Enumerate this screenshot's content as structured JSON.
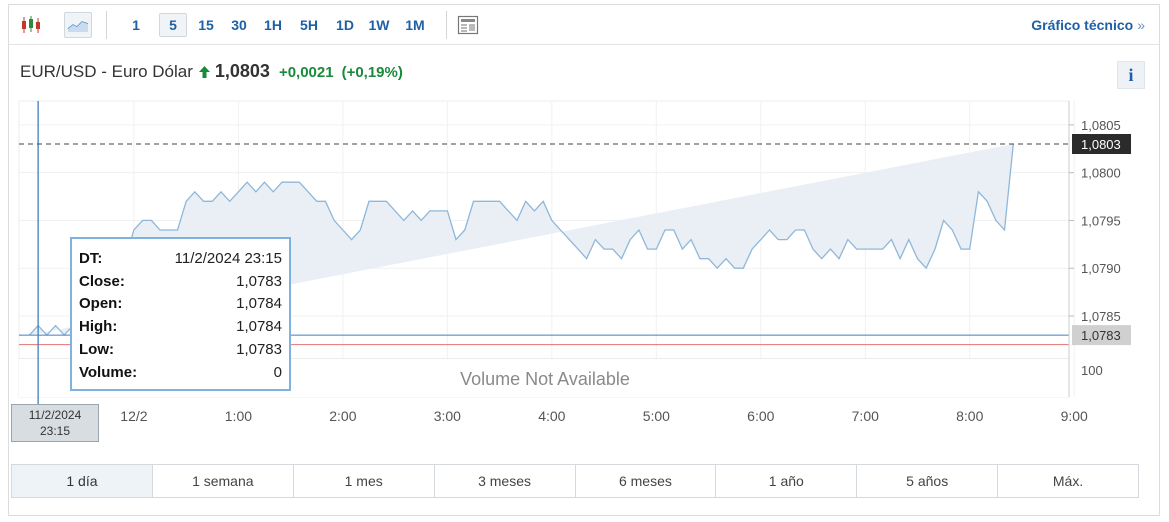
{
  "toolbar": {
    "intervals": [
      "1",
      "5",
      "15",
      "30",
      "1H",
      "5H",
      "1D",
      "1W",
      "1M"
    ],
    "active_interval": "5",
    "tech_link": "Gráfico técnico",
    "tech_arrow": "»"
  },
  "quote": {
    "name": "EUR/USD - Euro Dólar",
    "price": "1,0803",
    "change": "+0,0021",
    "change_pct": "(+0,19%)",
    "direction": "up",
    "up_color": "#1a8a3a"
  },
  "info_label": "i",
  "tooltip": {
    "rows": [
      {
        "key": "DT:",
        "value": "11/2/2024 23:15"
      },
      {
        "key": "Close:",
        "value": "1,0783"
      },
      {
        "key": "Open:",
        "value": "1,0784"
      },
      {
        "key": "High:",
        "value": "1,0784"
      },
      {
        "key": "Low:",
        "value": "1,0783"
      },
      {
        "key": "Volume:",
        "value": "0"
      }
    ]
  },
  "crosshair_date": {
    "line1": "11/2/2024",
    "line2": "23:15"
  },
  "ranges": [
    "1 día",
    "1 semana",
    "1 mes",
    "3 meses",
    "6 meses",
    "1 año",
    "5 años",
    "Máx."
  ],
  "active_range": "1 día",
  "chart_data": {
    "type": "area",
    "x": [
      -1.0,
      -0.917,
      -0.833,
      -0.75,
      -0.667,
      -0.583,
      -0.5,
      -0.417,
      -0.333,
      -0.25,
      -0.167,
      -0.083,
      0.0,
      0.083,
      0.167,
      0.25,
      0.333,
      0.417,
      0.5,
      0.583,
      0.667,
      0.75,
      0.833,
      0.917,
      1.0,
      1.083,
      1.167,
      1.25,
      1.333,
      1.417,
      1.5,
      1.583,
      1.667,
      1.75,
      1.833,
      1.917,
      2.0,
      2.083,
      2.167,
      2.25,
      2.333,
      2.417,
      2.5,
      2.583,
      2.667,
      2.75,
      2.833,
      2.917,
      3.0,
      3.083,
      3.167,
      3.25,
      3.333,
      3.417,
      3.5,
      3.583,
      3.667,
      3.75,
      3.833,
      3.917,
      4.0,
      4.083,
      4.167,
      4.25,
      4.333,
      4.417,
      4.5,
      4.583,
      4.667,
      4.75,
      4.833,
      4.917,
      5.0,
      5.083,
      5.167,
      5.25,
      5.333,
      5.417,
      5.5,
      5.583,
      5.667,
      5.75,
      5.833,
      5.917,
      6.0,
      6.083,
      6.167,
      6.25,
      6.333,
      6.417,
      6.5,
      6.583,
      6.667,
      6.75,
      6.833,
      6.917,
      7.0,
      7.083,
      7.167,
      7.25,
      7.333,
      7.417,
      7.5,
      7.583,
      7.667,
      7.75,
      7.833,
      7.917,
      8.0,
      8.083,
      8.167,
      8.25,
      8.333,
      8.417,
      8.5,
      8.583,
      8.667,
      8.75,
      8.833
    ],
    "values": [
      1.0783,
      1.0784,
      1.0783,
      1.0784,
      1.0783,
      1.0784,
      1.0786,
      1.0787,
      1.0788,
      1.079,
      1.0792,
      1.0791,
      1.0794,
      1.0795,
      1.0795,
      1.0794,
      1.0794,
      1.0794,
      1.0797,
      1.0798,
      1.0797,
      1.0797,
      1.0798,
      1.0797,
      1.0798,
      1.0799,
      1.0798,
      1.0799,
      1.0798,
      1.0799,
      1.0799,
      1.0799,
      1.0798,
      1.0797,
      1.0797,
      1.0795,
      1.0794,
      1.0793,
      1.0794,
      1.0797,
      1.0797,
      1.0797,
      1.0796,
      1.0795,
      1.0796,
      1.0795,
      1.0796,
      1.0796,
      1.0796,
      1.0793,
      1.0794,
      1.0797,
      1.0797,
      1.0797,
      1.0797,
      1.0796,
      1.0795,
      1.0797,
      1.0796,
      1.0797,
      1.0795,
      1.0794,
      1.0793,
      1.0792,
      1.0791,
      1.0793,
      1.0792,
      1.0792,
      1.0791,
      1.0793,
      1.0794,
      1.0792,
      1.0792,
      1.0794,
      1.0794,
      1.0792,
      1.0793,
      1.0791,
      1.0791,
      1.079,
      1.0791,
      1.079,
      1.079,
      1.0792,
      1.0793,
      1.0794,
      1.0793,
      1.0793,
      1.0794,
      1.0794,
      1.0792,
      1.0791,
      1.0792,
      1.0791,
      1.0793,
      1.0792,
      1.0792,
      1.0792,
      1.0792,
      1.0793,
      1.0791,
      1.0793,
      1.0791,
      1.079,
      1.0792,
      1.0795,
      1.0794,
      1.0792,
      1.0792,
      1.0798,
      1.0797,
      1.0795,
      1.0794,
      1.0803
    ],
    "y_ticks": [
      "1,0805",
      "1,0800",
      "1,0795",
      "1,0790",
      "1,0785"
    ],
    "y_tick_values": [
      1.0805,
      1.08,
      1.0795,
      1.079,
      1.0785
    ],
    "ylim": [
      1.07805,
      1.08075
    ],
    "x_ticks": [
      "12/2",
      "1:00",
      "2:00",
      "3:00",
      "4:00",
      "5:00",
      "6:00",
      "7:00",
      "8:00",
      "9:00"
    ],
    "x_tick_values": [
      0,
      1,
      2,
      3,
      4,
      5,
      6,
      7,
      8,
      9
    ],
    "xlim": [
      -1.1,
      8.95
    ],
    "last_label": "1,0803",
    "last_value": 1.0803,
    "crosshair_label": "1,0783",
    "crosshair_value": 1.0783,
    "crosshair_x": -0.917,
    "ref_value": 1.0782,
    "volume_axis_tick": "100",
    "volume_note": "Volume Not Available",
    "line_color": "#8fb7d9",
    "area_color": "#e9eff5",
    "ref_color": "#e57373",
    "crosshair_color": "#3f7fc0",
    "grid": true
  }
}
